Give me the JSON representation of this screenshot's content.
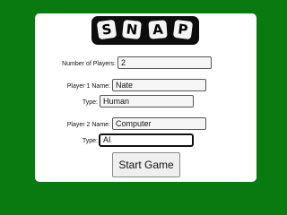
{
  "logo": {
    "letters": [
      "S",
      "N",
      "A",
      "P"
    ]
  },
  "form": {
    "num_players": {
      "label": "Number of Players:",
      "value": "2"
    },
    "player1": {
      "name_label": "Player 1 Name:",
      "name_value": "Nate",
      "type_label": "Type:",
      "type_value": "Human"
    },
    "player2": {
      "name_label": "Player 2 Name:",
      "name_value": "Computer",
      "type_label": "Type:",
      "type_value": "AI"
    },
    "start_label": "Start Game"
  },
  "colors": {
    "background": "#087a10",
    "panel": "#ffffff",
    "logo_bg": "#0d0d0d",
    "tile_bg": "#f4f4f4"
  }
}
